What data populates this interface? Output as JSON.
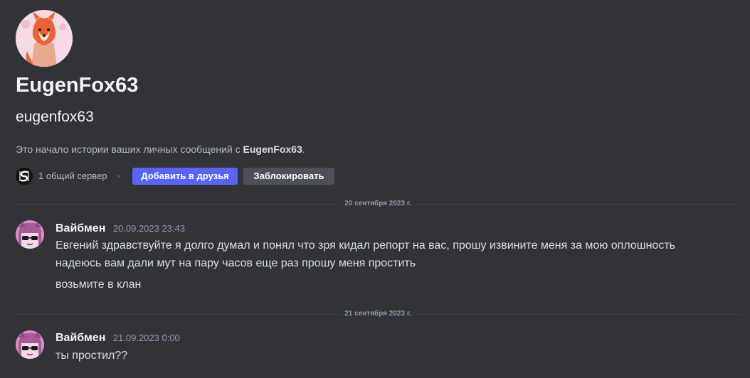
{
  "profile": {
    "display_name": "EugenFox63",
    "username": "eugenfox63",
    "intro_prefix": "Это начало истории ваших личных сообщений с",
    "intro_name": "EugenFox63",
    "intro_suffix": ".",
    "mutual_servers": "1 общий сервер",
    "add_friend_label": "Добавить в друзья",
    "block_label": "Заблокировать"
  },
  "dividers": [
    {
      "label": "20 сентября 2023 г."
    },
    {
      "label": "21 сентября 2023 г."
    }
  ],
  "messages": [
    {
      "author": "Вайбмен",
      "timestamp": "20.09.2023 23:43",
      "lines": [
        "Евгений здравствуйте я долго думал и понял что зря кидал репорт на вас, прошу извините меня за мою оплошность",
        "надеюсь вам дали мут на пару часов еще раз прошу меня простить",
        "возьмите в клан"
      ]
    },
    {
      "author": "Вайбмен",
      "timestamp": "21.09.2023 0:00",
      "lines": [
        "ты простил??"
      ]
    }
  ],
  "colors": {
    "background": "#313338",
    "primary_button": "#5865f2",
    "secondary_button": "#4e5058"
  }
}
